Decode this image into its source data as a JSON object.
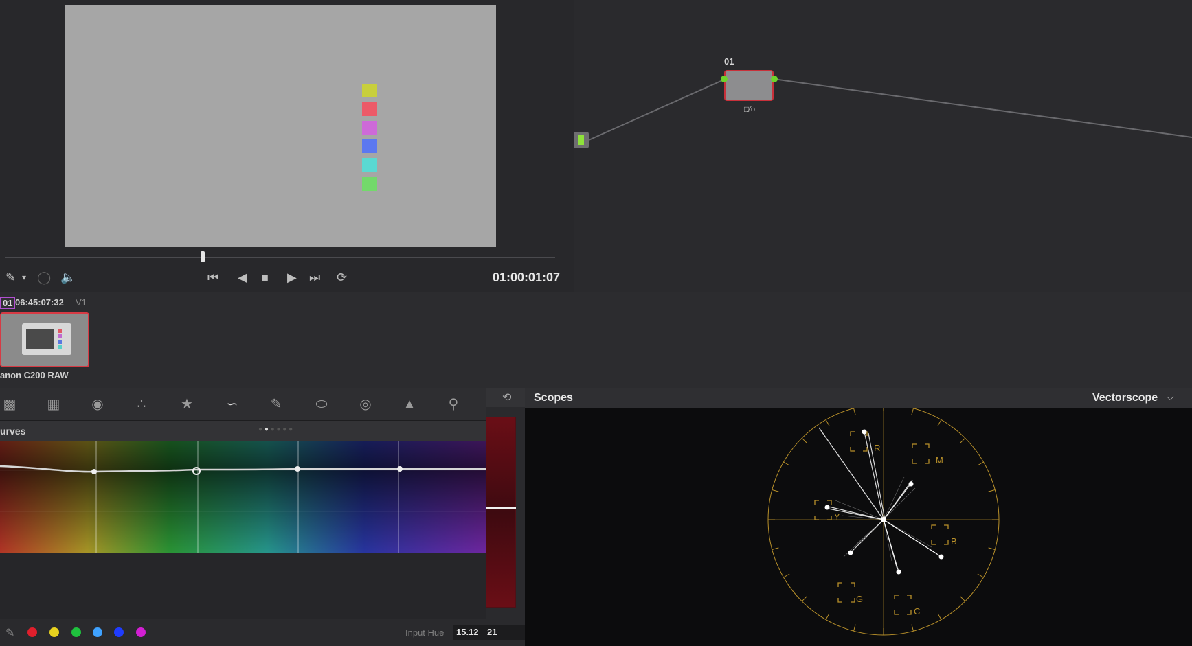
{
  "viewer": {
    "timecode": "01:00:01:07",
    "swatch_colors": [
      "#c8cf3c",
      "#ec5a68",
      "#cd6ad8",
      "#5c78f0",
      "#5ad9d2",
      "#73d96b"
    ],
    "controls": {
      "picker_icon": "eyedropper-icon",
      "speaker_icon": "speaker-icon",
      "transport": [
        "skip-to-start-icon",
        "step-back-icon",
        "stop-icon",
        "play-icon",
        "skip-to-end-icon",
        "loop-icon"
      ]
    }
  },
  "node_editor": {
    "node_label": "01"
  },
  "clips": {
    "clip_number": "01",
    "timecode": "06:45:07:32",
    "track": "V1",
    "clip_name": "anon C200 RAW"
  },
  "curves": {
    "title": "urves",
    "input_hue_label": "Input Hue",
    "input_hue_value": "15.12",
    "colors": [
      "#e01f2c",
      "#e8d21f",
      "#1fc23e",
      "#3fa2ff",
      "#1f3cff",
      "#d31fd3"
    ],
    "tool_icons": [
      "camera-raw-icon",
      "color-match-icon",
      "color-wheels-icon",
      "rgb-mixer-icon",
      "motion-effects-icon",
      "curves-icon",
      "qualifier-icon",
      "window-icon",
      "tracker-icon",
      "blur-icon",
      "key-icon",
      "sizing-icon"
    ]
  },
  "mid": {
    "value": "21"
  },
  "scopes": {
    "title": "Scopes",
    "mode": "Vectorscope",
    "targets": [
      "R",
      "M",
      "Y",
      "B",
      "G",
      "C"
    ],
    "graticule_color": "#b8902a"
  }
}
